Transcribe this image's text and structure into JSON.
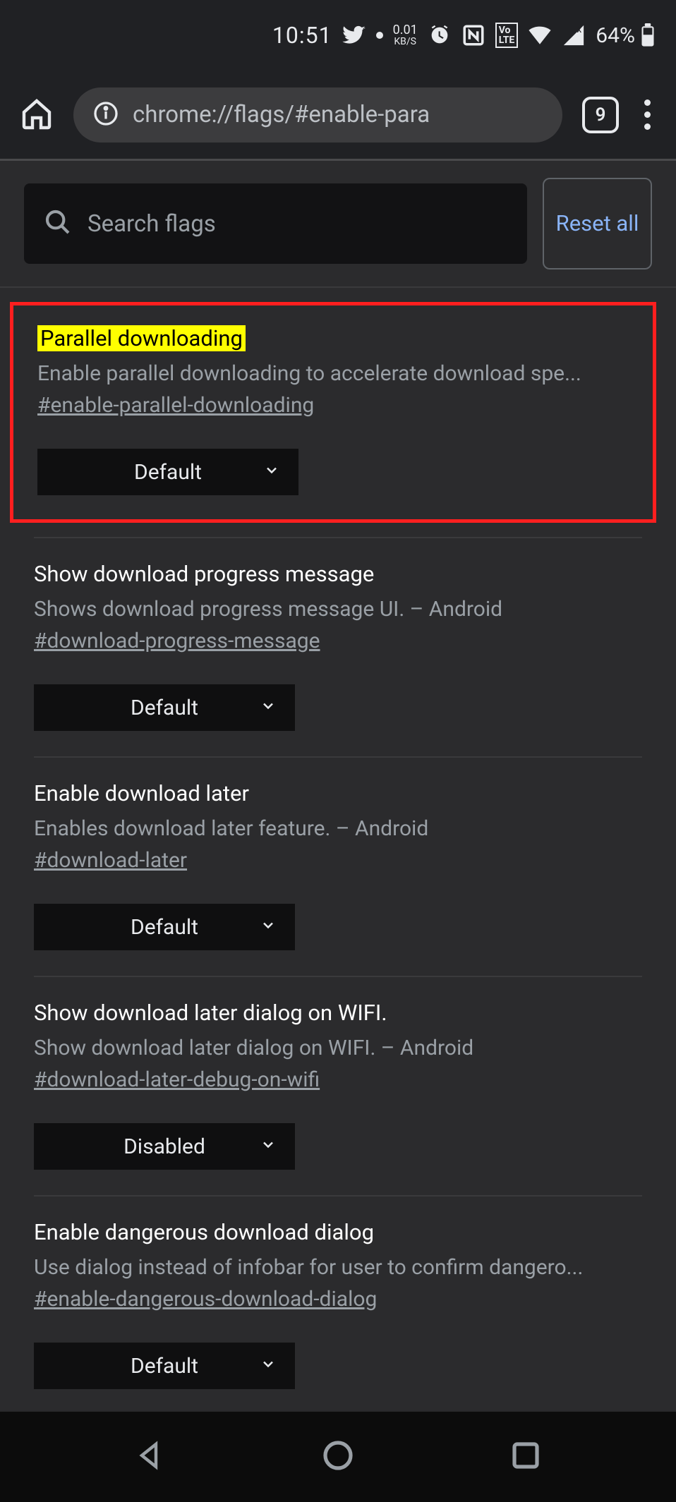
{
  "status": {
    "time": "10:51",
    "net_rate_top": "0.01",
    "net_rate_bot": "KB/S",
    "battery_pct": "64%"
  },
  "browser": {
    "url": "chrome://flags/#enable-para",
    "tab_count": "9"
  },
  "search": {
    "placeholder": "Search flags",
    "reset_label": "Reset all"
  },
  "flags": [
    {
      "title": "Parallel downloading",
      "desc": "Enable parallel downloading to accelerate download spe...",
      "hash": "#enable-parallel-downloading",
      "value": "Default",
      "highlight": true
    },
    {
      "title": "Show download progress message",
      "desc": "Shows download progress message UI. – Android",
      "hash": "#download-progress-message",
      "value": "Default",
      "highlight": false
    },
    {
      "title": "Enable download later",
      "desc": "Enables download later feature. – Android",
      "hash": "#download-later",
      "value": "Default",
      "highlight": false
    },
    {
      "title": "Show download later dialog on WIFI.",
      "desc": "Show download later dialog on WIFI. – Android",
      "hash": "#download-later-debug-on-wifi",
      "value": "Disabled",
      "highlight": false
    },
    {
      "title": "Enable dangerous download dialog",
      "desc": "Use dialog instead of infobar for user to confirm dangero...",
      "hash": "#enable-dangerous-download-dialog",
      "value": "Default",
      "highlight": false
    }
  ]
}
